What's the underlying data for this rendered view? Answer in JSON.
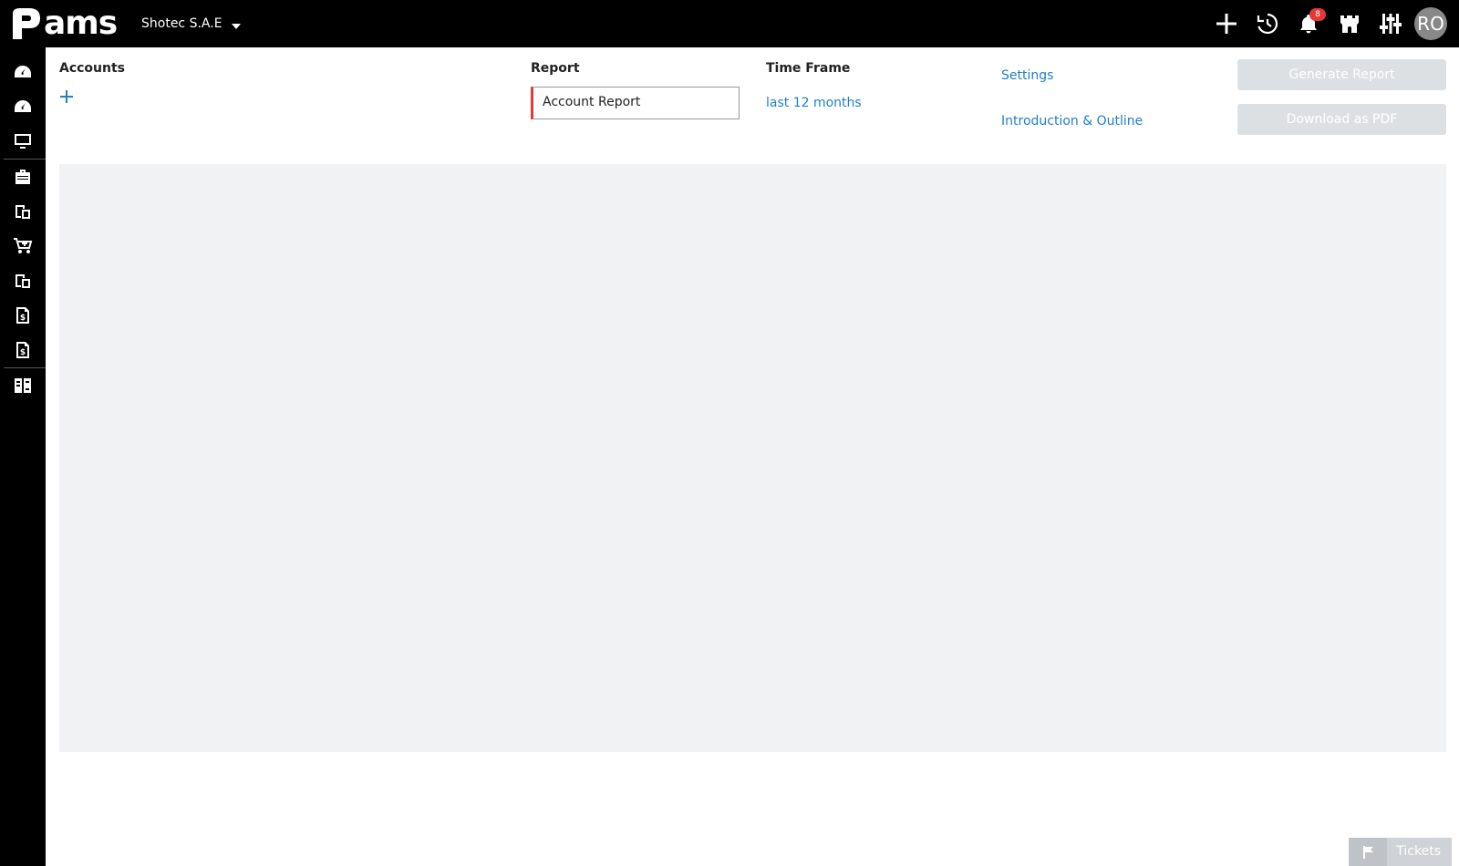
{
  "brand": {
    "logo_text": "ams"
  },
  "header": {
    "company": "Shotec S.A.E",
    "notifications_count": "8",
    "user_initials": "RO",
    "icons": [
      "plus-icon",
      "history-icon",
      "bell-icon",
      "castle-icon",
      "sliders-icon"
    ]
  },
  "sidebar": {
    "items": [
      {
        "icon": "dashboard-icon"
      },
      {
        "icon": "dashboard-icon"
      },
      {
        "icon": "monitor-icon"
      },
      {
        "icon": "briefcase-icon"
      },
      {
        "icon": "documents-icon"
      },
      {
        "icon": "cart-icon"
      },
      {
        "icon": "documents-icon"
      },
      {
        "icon": "invoice-dollar-icon"
      },
      {
        "icon": "invoice-dollar-icon"
      },
      {
        "icon": "columns-icon"
      }
    ]
  },
  "filters": {
    "accounts_label": "Accounts",
    "report_label": "Report",
    "report_value": "Account Report",
    "timeframe_label": "Time Frame",
    "timeframe_value": "last 12 months",
    "settings_link": "Settings",
    "intro_link": "Introduction & Outline"
  },
  "actions": {
    "generate_label": "Generate Report",
    "download_label": "Download as PDF"
  },
  "footer": {
    "tickets_label": "Tickets"
  },
  "colors": {
    "accent": "#1f7fc9",
    "error_border": "#e53935",
    "disabled_button": "#dde0e3",
    "panel": "#f1f2f3"
  }
}
